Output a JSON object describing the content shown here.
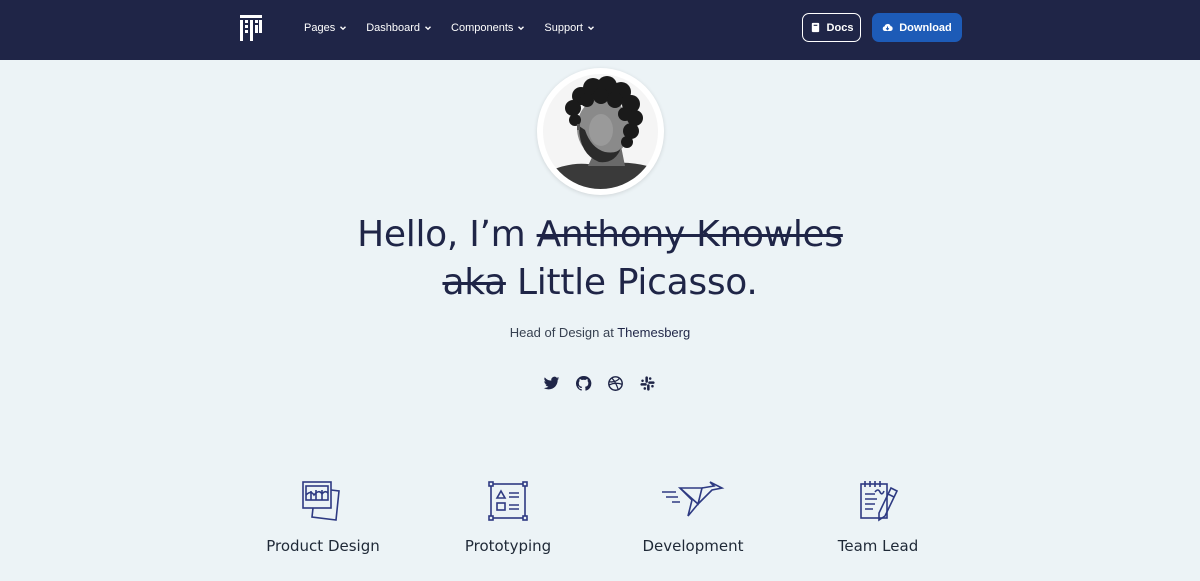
{
  "navbar": {
    "menu": [
      {
        "label": "Pages"
      },
      {
        "label": "Dashboard"
      },
      {
        "label": "Components"
      },
      {
        "label": "Support"
      }
    ],
    "docs_label": "Docs",
    "download_label": "Download"
  },
  "hero": {
    "greeting": "Hello, I’m ",
    "struck_name": "Anthony Knowles",
    "struck_aka": "aka",
    "nickname": " Little Picasso.",
    "subtitle_prefix": "Head of Design at ",
    "company": "Themesberg",
    "socials": [
      "twitter-icon",
      "github-icon",
      "dribbble-icon",
      "slack-icon"
    ]
  },
  "features": [
    {
      "label": "Product Design",
      "icon": "photo-gallery-icon"
    },
    {
      "label": "Prototyping",
      "icon": "wireframe-icon"
    },
    {
      "label": "Development",
      "icon": "paper-plane-origami-icon"
    },
    {
      "label": "Team Lead",
      "icon": "notepad-pen-icon"
    }
  ],
  "colors": {
    "navbar_bg": "#1f2547",
    "page_bg": "#ecf3f6",
    "download_button": "#1d5bb7",
    "icon_stroke": "#2e3a82"
  }
}
